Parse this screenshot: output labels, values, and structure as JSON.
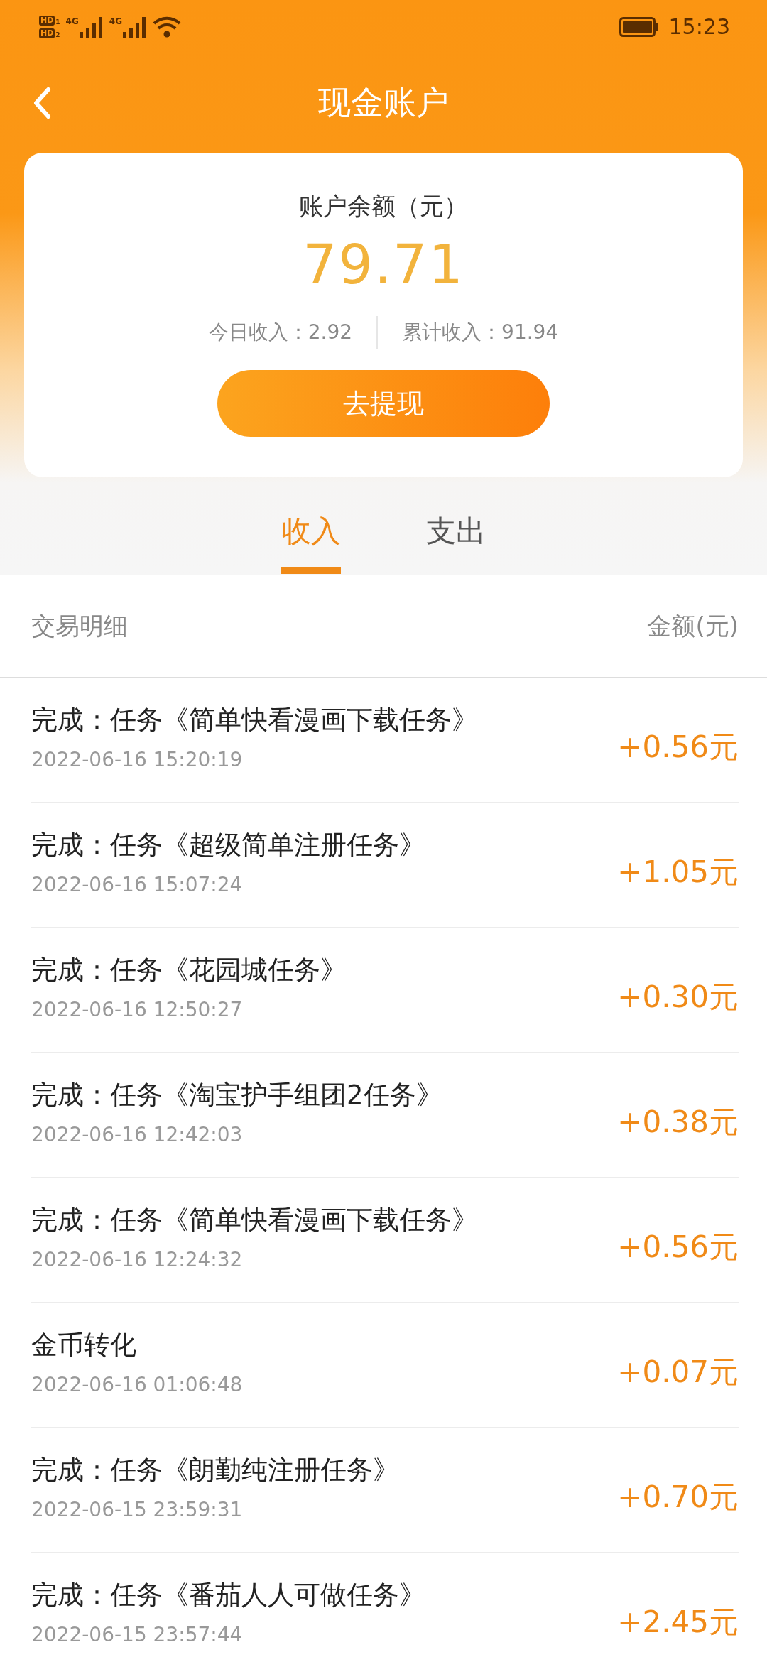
{
  "status_bar": {
    "sim_badges": [
      {
        "label": "HD",
        "slot": "1"
      },
      {
        "label": "HD",
        "slot": "2"
      }
    ],
    "signals": [
      "4G",
      "4G"
    ],
    "time": "15:23"
  },
  "header": {
    "title": "现金账户"
  },
  "balance_card": {
    "label": "账户余额（元）",
    "amount": "79.71",
    "today": "今日收入：2.92",
    "total": "累计收入：91.94",
    "button": "去提现"
  },
  "tabs": [
    {
      "label": "收入",
      "selected": true
    },
    {
      "label": "支出",
      "selected": false
    }
  ],
  "list_header": {
    "left": "交易明细",
    "right": "金额(元)"
  },
  "transactions": [
    {
      "title": "完成：任务《简单快看漫画下载任务》",
      "time": "2022-06-16 15:20:19",
      "amount": "+0.56元"
    },
    {
      "title": "完成：任务《超级简单注册任务》",
      "time": "2022-06-16 15:07:24",
      "amount": "+1.05元"
    },
    {
      "title": "完成：任务《花园城任务》",
      "time": "2022-06-16 12:50:27",
      "amount": "+0.30元"
    },
    {
      "title": "完成：任务《淘宝护手组团2任务》",
      "time": "2022-06-16 12:42:03",
      "amount": "+0.38元"
    },
    {
      "title": "完成：任务《简单快看漫画下载任务》",
      "time": "2022-06-16 12:24:32",
      "amount": "+0.56元"
    },
    {
      "title": "金币转化",
      "time": "2022-06-16 01:06:48",
      "amount": "+0.07元"
    },
    {
      "title": "完成：任务《朗勤纯注册任务》",
      "time": "2022-06-15 23:59:31",
      "amount": "+0.70元"
    },
    {
      "title": "完成：任务《番茄人人可做任务》",
      "time": "2022-06-15 23:57:44",
      "amount": "+2.45元"
    }
  ]
}
